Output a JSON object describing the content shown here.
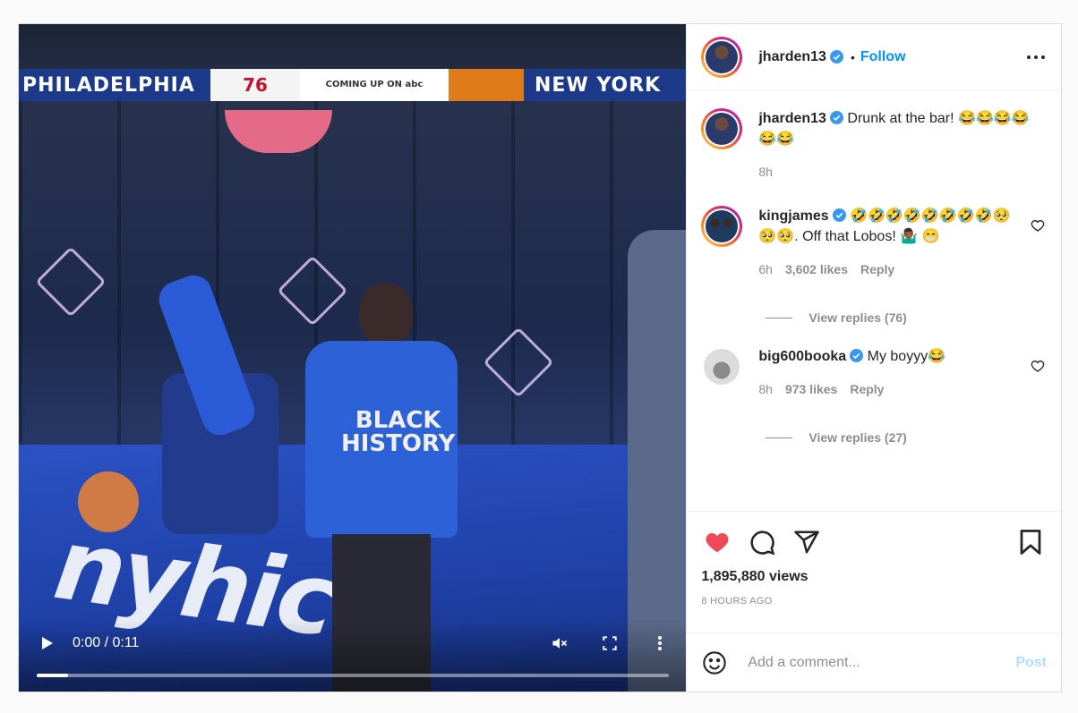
{
  "video": {
    "banner_left": "PHILADELPHIA",
    "banner_mid": "COMING UP ON",
    "banner_network": "abc",
    "banner_right": "NEW YORK",
    "time": "0:00 / 0:11",
    "progress": 0.05
  },
  "header": {
    "username": "jharden13",
    "dot": "•",
    "follow_label": "Follow"
  },
  "caption": {
    "username": "jharden13",
    "text": "Drunk at the bar! 😂😂😂😂😂😂",
    "time": "8h"
  },
  "comments": [
    {
      "username": "kingjames",
      "text": "🤣🤣🤣🤣🤣🤣🤣🤣🥺🥺🥺. Off that Lobos! 🤷🏾‍♂️ 😁",
      "time": "6h",
      "likes": "3,602 likes",
      "reply_label": "Reply",
      "view_replies": "View replies (76)"
    },
    {
      "username": "big600booka",
      "text": "My boyyy😂",
      "time": "8h",
      "likes": "973 likes",
      "reply_label": "Reply",
      "view_replies": "View replies (27)"
    }
  ],
  "stats": {
    "views": "1,895,880 views",
    "ago": "8 HOURS AGO"
  },
  "composer": {
    "placeholder": "Add a comment...",
    "post_label": "Post"
  },
  "colors": {
    "like_red": "#ed4956",
    "follow_blue": "#0095f6",
    "verified_blue": "#3897f0"
  }
}
